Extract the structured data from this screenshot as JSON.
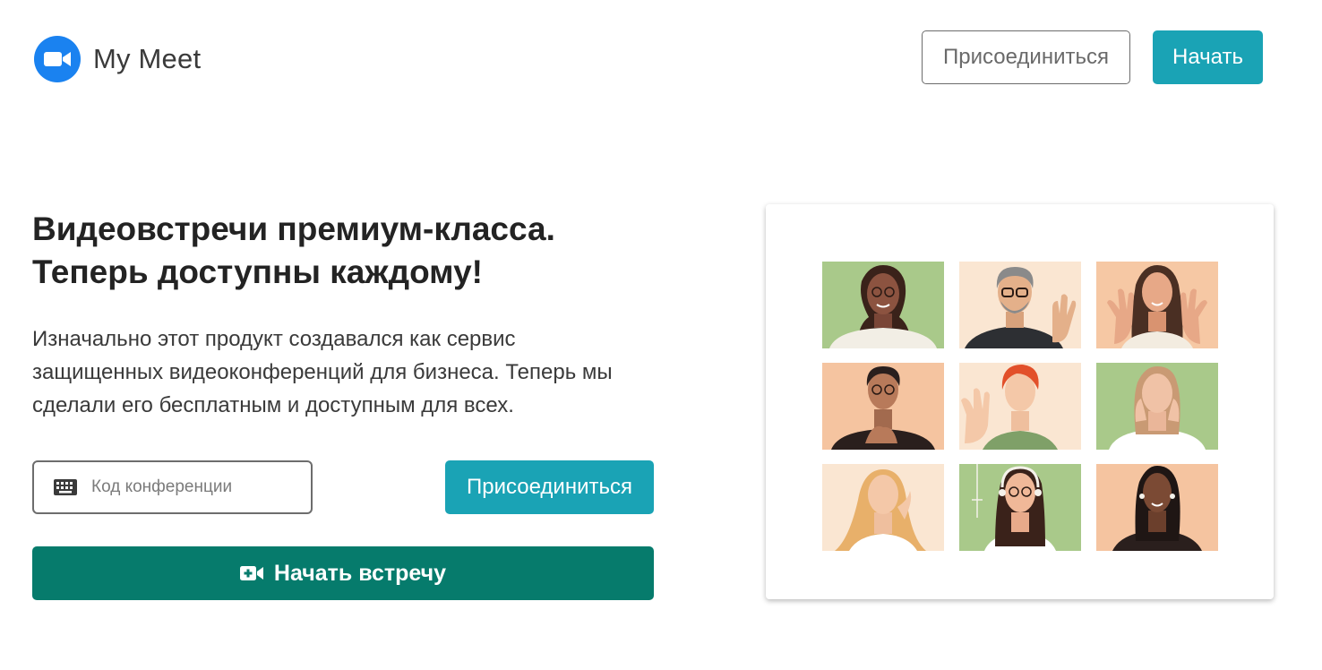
{
  "header": {
    "logo_icon": "video-camera-icon",
    "app_name": "My Meet",
    "join_label": "Присоединиться",
    "start_label": "Начать"
  },
  "hero": {
    "title_line1": "Видеовстречи премиум-класса.",
    "title_line2": "Теперь доступны каждому!",
    "text_line1": "Изначально этот продукт создавался как сервис",
    "text_line2": "защищенных видеоконференций для бизнеса. Теперь мы",
    "text_line3": "сделали его бесплатным и доступным для всех."
  },
  "join_form": {
    "input_icon": "keyboard-icon",
    "code_placeholder": "Код конференции",
    "code_value": "",
    "join_label": "Присоединиться",
    "start_meeting_icon": "video-plus-icon",
    "start_meeting_label": "Начать встречу"
  },
  "colors": {
    "accent": "#1aa3b5",
    "primary_dark": "#067b6c",
    "logo_blue": "#1a82f0"
  }
}
